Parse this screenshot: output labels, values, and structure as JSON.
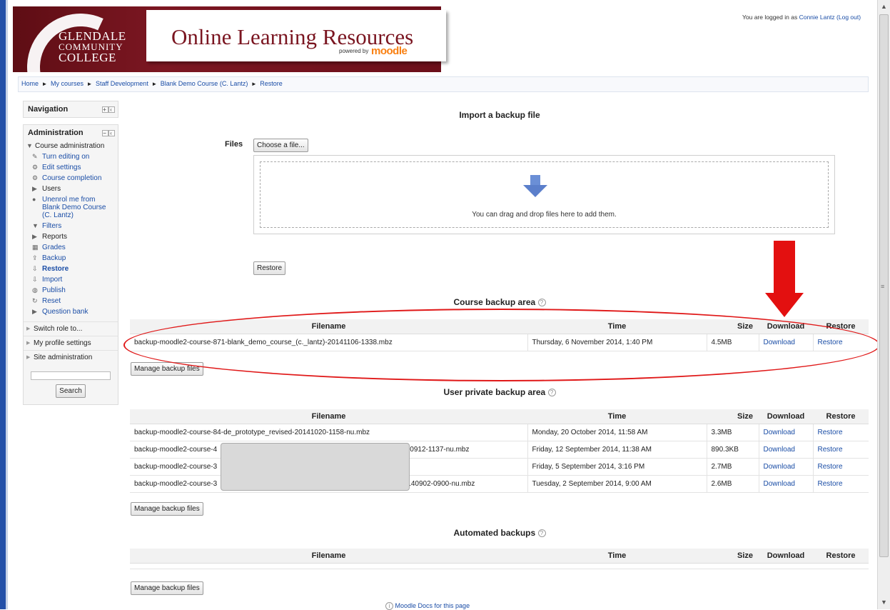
{
  "header": {
    "college_line1": "GLENDALE",
    "college_line2": "COMMUNITY",
    "college_line3": "COLLEGE",
    "site_title": "Online Learning Resources",
    "powered_by": "powered by",
    "moodle_logo": "moodle",
    "login_prefix": "You are logged in as",
    "login_user": "Connie Lantz",
    "logout": "(Log out)"
  },
  "breadcrumb": [
    "Home",
    "My courses",
    "Staff Development",
    "Blank Demo Course (C. Lantz)",
    "Restore"
  ],
  "breadcrumb_sep": "►",
  "sidebar": {
    "navigation_title": "Navigation",
    "administration_title": "Administration",
    "course_admin": "Course administration",
    "items": [
      {
        "label": "Turn editing on",
        "icon": "pencil-icon"
      },
      {
        "label": "Edit settings",
        "icon": "gear-icon"
      },
      {
        "label": "Course completion",
        "icon": "gear-icon"
      },
      {
        "label": "Users",
        "icon": "caret-right-icon"
      },
      {
        "label": "Unenrol me from Blank Demo Course (C. Lantz)",
        "icon": "user-icon"
      },
      {
        "label": "Filters",
        "icon": "filter-icon"
      },
      {
        "label": "Reports",
        "icon": "caret-right-icon"
      },
      {
        "label": "Grades",
        "icon": "grades-icon"
      },
      {
        "label": "Backup",
        "icon": "backup-icon"
      },
      {
        "label": "Restore",
        "icon": "restore-icon"
      },
      {
        "label": "Import",
        "icon": "import-icon"
      },
      {
        "label": "Publish",
        "icon": "globe-icon"
      },
      {
        "label": "Reset",
        "icon": "reset-icon"
      },
      {
        "label": "Question bank",
        "icon": "caret-right-icon"
      }
    ],
    "switch_role": "Switch role to...",
    "profile_settings": "My profile settings",
    "site_admin": "Site administration",
    "search_button": "Search"
  },
  "import": {
    "heading": "Import a backup file",
    "files_label": "Files",
    "choose_button": "Choose a file...",
    "drop_text": "You can drag and drop files here to add them.",
    "restore_button": "Restore"
  },
  "columns": {
    "filename": "Filename",
    "time": "Time",
    "size": "Size",
    "download": "Download",
    "restore": "Restore"
  },
  "course_backup": {
    "heading": "Course backup area",
    "rows": [
      {
        "filename": "backup-moodle2-course-871-blank_demo_course_(c._lantz)-20141106-1338.mbz",
        "time": "Thursday, 6 November 2014, 1:40 PM",
        "size": "4.5MB",
        "download": "Download",
        "restore": "Restore"
      }
    ],
    "manage_button": "Manage backup files"
  },
  "user_backup": {
    "heading": "User private backup area",
    "rows": [
      {
        "filename": "backup-moodle2-course-84-de_prototype_revised-20141020-1158-nu.mbz",
        "time": "Monday, 20 October 2014, 11:58 AM",
        "size": "3.3MB",
        "download": "Download",
        "restore": "Restore"
      },
      {
        "filename_start": "backup-moodle2-course-4",
        "filename_end": "140912-1137-nu.mbz",
        "time": "Friday, 12 September 2014, 11:38 AM",
        "size": "890.3KB",
        "download": "Download",
        "restore": "Restore"
      },
      {
        "filename_start": "backup-moodle2-course-3",
        "filename_end": "",
        "time": "Friday, 5 September 2014, 3:16 PM",
        "size": "2.7MB",
        "download": "Download",
        "restore": "Restore"
      },
      {
        "filename_start": "backup-moodle2-course-3",
        "filename_end": "20140902-0900-nu.mbz",
        "time": "Tuesday, 2 September 2014, 9:00 AM",
        "size": "2.6MB",
        "download": "Download",
        "restore": "Restore"
      }
    ],
    "manage_button": "Manage backup files"
  },
  "automated_backup": {
    "heading": "Automated backups",
    "manage_button": "Manage backup files"
  },
  "footer": {
    "docs_link": "Moodle Docs for this page"
  },
  "colors": {
    "annotation_red": "#e01818",
    "banner_maroon": "#7c1722",
    "link_blue": "#1a4da6",
    "window_edge": "#2450a8"
  }
}
